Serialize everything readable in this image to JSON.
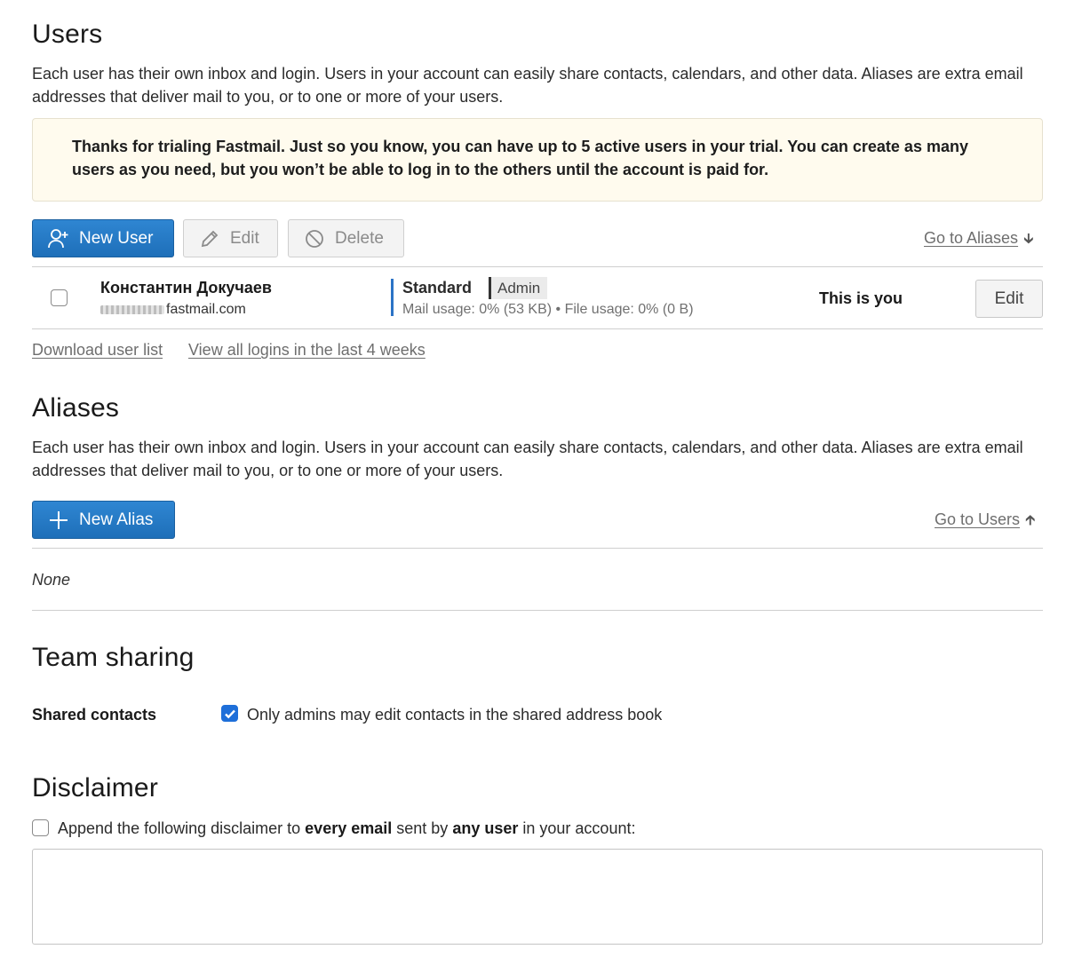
{
  "users": {
    "title": "Users",
    "description": "Each user has their own inbox and login. Users in your account can easily share contacts, calendars, and other data. Aliases are extra email addresses that deliver mail to you, or to one or more of your users.",
    "notice": "Thanks for trialing Fastmail. Just so you know, you can have up to 5 active users in your trial. You can create as many users as you need, but you won’t be able to log in to the others until the account is paid for.",
    "toolbar": {
      "new_user_label": "New User",
      "edit_label": "Edit",
      "delete_label": "Delete",
      "go_to_aliases": "Go to Aliases"
    },
    "rows": [
      {
        "name": "Константин Докучаев",
        "email_domain": "fastmail.com",
        "plan": "Standard",
        "badge": "Admin",
        "usage": "Mail usage: 0% (53 KB) • File usage: 0% (0 B)",
        "status": "This is you",
        "edit_label": "Edit"
      }
    ],
    "links": {
      "download": "Download user list",
      "logins": "View all logins in the last 4 weeks"
    }
  },
  "aliases": {
    "title": "Aliases",
    "description": "Each user has their own inbox and login. Users in your account can easily share contacts, calendars, and other data. Aliases are extra email addresses that deliver mail to you, or to one or more of your users.",
    "new_alias_label": "New Alias",
    "go_to_users": "Go to Users",
    "empty_text": "None"
  },
  "team_sharing": {
    "title": "Team sharing",
    "shared_contacts_label": "Shared contacts",
    "only_admins_label": "Only admins may edit contacts in the shared address book",
    "only_admins_checked": true
  },
  "disclaimer": {
    "title": "Disclaimer",
    "append_prefix": "Append the following disclaimer to",
    "bold1": "every email",
    "mid": "sent by",
    "bold2": "any user",
    "suffix": "in your account:",
    "checked": false,
    "textarea_value": ""
  },
  "colors": {
    "primary": "#1e6fb9",
    "notice_bg": "#fffbee",
    "checkbox_checked": "#1e6fd9"
  }
}
